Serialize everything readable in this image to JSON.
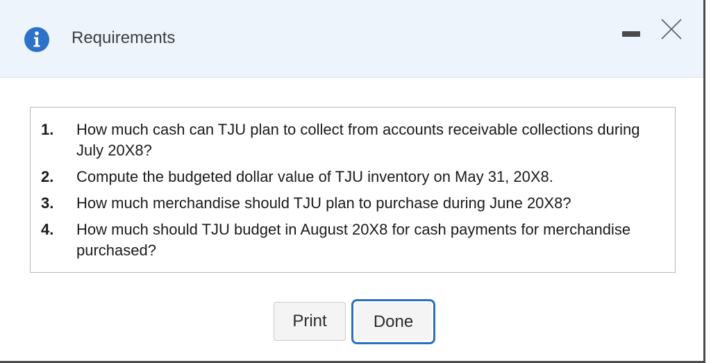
{
  "dialog": {
    "title": "Requirements",
    "icon": "info-icon",
    "colors": {
      "header_bg": "#eef4fb",
      "info_icon": "#2b72c8",
      "focus_border": "#2a6fc0"
    }
  },
  "requirements": [
    {
      "num": "1.",
      "text": "How much cash can TJU plan to collect from accounts receivable collections during July 20X8?"
    },
    {
      "num": "2.",
      "text": "Compute the budgeted dollar value of TJU inventory on May 31, 20X8."
    },
    {
      "num": "3.",
      "text": "How much merchandise should TJU plan to purchase during June 20X8?"
    },
    {
      "num": "4.",
      "text": "How much should TJU budget in August 20X8 for cash payments for merchandise purchased?"
    }
  ],
  "buttons": {
    "print_label": "Print",
    "done_label": "Done"
  }
}
